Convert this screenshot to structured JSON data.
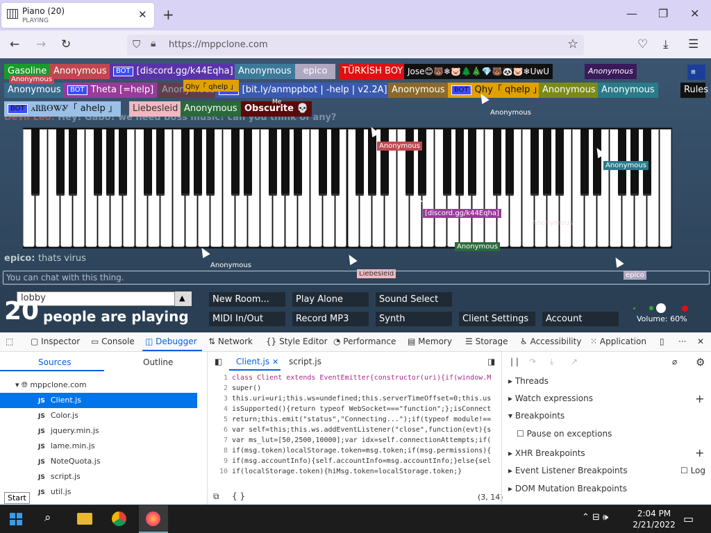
{
  "browser": {
    "tab_title": "Piano (20)",
    "tab_status": "PLAYING",
    "url": "https://mppclone.com"
  },
  "room": {
    "name": "lobby",
    "player_count": "20",
    "count_text": "people are playing",
    "volume": "Volume: 60%"
  },
  "users": [
    "Gasoline",
    "Anonymous",
    "[discord.gg/k44Eqha]",
    "Anonymous",
    "epico",
    "TÜRKİSH BOY",
    "Jose😊🐻❄🐷🌲🎄💎🐻🐼🐷❄UwU",
    "Anonymous",
    "Anonymous",
    "Theta [=help]",
    "Anonymous",
    "[bit.ly/anmppbot | -help | v2.2A]",
    "Anonymous",
    "Qhy「 qhelp 」",
    "Anonymous",
    "Anonymous",
    "ꭺᏒᏒᎾᏔᎽ「 ahelp 」",
    "Liebesleid",
    "Anonymous",
    "Obscurite 💀"
  ],
  "bot_tag": "BOT",
  "rules": "Rules",
  "me_tag": "Me",
  "chat": [
    {
      "name": "Devil Leo:",
      "msg": "Hey! Gabo! we need boss music! can you think of any?"
    },
    {
      "name": "epico:",
      "msg": "thats virus"
    }
  ],
  "chat_placeholder": "You can chat with this thing.",
  "cursor_labels": [
    "Anonymous",
    "Qhy「 qhelp 」",
    "Anonymous",
    "Anonymous",
    "Anonymous",
    "[discord.gg/k44Eqha]",
    "Anonymous",
    "Anonymous",
    "Liebesleid",
    "epico",
    "Anonymous"
  ],
  "buttons": [
    "New Room...",
    "Play Alone",
    "Sound Select",
    "MIDI In/Out",
    "Record MP3",
    "Synth",
    "Client Settings",
    "Account"
  ],
  "devtools": {
    "tabs": [
      "Inspector",
      "Console",
      "Debugger",
      "Network",
      "Style Editor",
      "Performance",
      "Memory",
      "Storage",
      "Accessibility",
      "Application"
    ],
    "left_tabs": [
      "Sources",
      "Outline"
    ],
    "domain": "mppclone.com",
    "files": [
      "Client.js",
      "Color.js",
      "jquery.min.js",
      "lame.min.js",
      "NoteQuota.js",
      "script.js",
      "util.js"
    ],
    "editor_tabs": [
      "Client.js",
      "script.js"
    ],
    "code": [
      "class Client extends EventEmitter{constructor(uri){if(window.M",
      "super()",
      "this.uri=uri;this.ws=undefined;this.serverTimeOffset=0;this.us",
      "isSupported(){return typeof WebSocket===\"function\";};isConnect",
      "return;this.emit(\"status\",\"Connecting...\");if(typeof module!==",
      "var self=this;this.ws.addEventListener(\"close\",function(evt){s",
      "var ms_lut=[50,2500,10000];var idx=self.connectionAttempts;if(",
      "if(msg.token)localStorage.token=msg.token;if(msg.permissions){",
      "if(msg.accountInfo){self.accountInfo=msg.accountInfo;}else{sel",
      "if(localStorage.token){hiMsg.token=localStorage.token;}"
    ],
    "position": "(3, 14)",
    "braces": "{ }",
    "right_panel": [
      "Threads",
      "Watch expressions",
      "Breakpoints",
      "Pause on exceptions",
      "XHR Breakpoints",
      "Event Listener Breakpoints",
      "Log",
      "DOM Mutation Breakpoints"
    ],
    "start_tooltip": "Start"
  },
  "taskbar": {
    "time": "2:04 PM",
    "date": "2/21/2022"
  }
}
